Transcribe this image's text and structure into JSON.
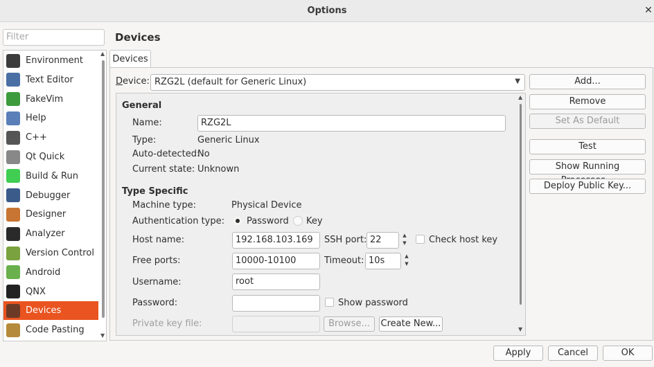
{
  "window": {
    "title": "Options",
    "close_glyph": "✕"
  },
  "filter": {
    "placeholder": "Filter",
    "value": ""
  },
  "sidebar": {
    "items": [
      {
        "label": "Environment",
        "icon": "environment-icon",
        "color": "#3c3c3c"
      },
      {
        "label": "Text Editor",
        "icon": "text-editor-icon",
        "color": "#4a6fa5"
      },
      {
        "label": "FakeVim",
        "icon": "fakevim-icon",
        "color": "#3d9b3d"
      },
      {
        "label": "Help",
        "icon": "help-icon",
        "color": "#5b7fb8"
      },
      {
        "label": "C++",
        "icon": "cpp-icon",
        "color": "#555555"
      },
      {
        "label": "Qt Quick",
        "icon": "qt-quick-icon",
        "color": "#888888"
      },
      {
        "label": "Build & Run",
        "icon": "build-run-icon",
        "color": "#41cd52"
      },
      {
        "label": "Debugger",
        "icon": "debugger-icon",
        "color": "#3b5b8a"
      },
      {
        "label": "Designer",
        "icon": "designer-icon",
        "color": "#c87533"
      },
      {
        "label": "Analyzer",
        "icon": "analyzer-icon",
        "color": "#2a2a2a"
      },
      {
        "label": "Version Control",
        "icon": "version-control-icon",
        "color": "#7aa33f"
      },
      {
        "label": "Android",
        "icon": "android-icon",
        "color": "#6ab04c"
      },
      {
        "label": "QNX",
        "icon": "qnx-icon",
        "color": "#222222"
      },
      {
        "label": "Devices",
        "icon": "devices-icon",
        "color": "#6b3a26"
      },
      {
        "label": "Code Pasting",
        "icon": "code-pasting-icon",
        "color": "#b58a3a"
      }
    ],
    "selected": "Devices"
  },
  "page": {
    "title": "Devices",
    "tab": "Devices"
  },
  "device": {
    "label": "Device:",
    "value": "RZG2L (default for Generic Linux)"
  },
  "actions": {
    "add": "Add...",
    "remove": "Remove",
    "set_default": "Set As Default",
    "test": "Test",
    "show_processes": "Show Running Processes...",
    "deploy_key": "Deploy Public Key..."
  },
  "general": {
    "heading": "General",
    "name_label": "Name:",
    "name_value": "RZG2L",
    "type_label": "Type:",
    "type_value": "Generic Linux",
    "auto_label": "Auto-detected:",
    "auto_value": "No",
    "state_label": "Current state:",
    "state_value": "Unknown"
  },
  "specific": {
    "heading": "Type Specific",
    "machine_label": "Machine type:",
    "machine_value": "Physical Device",
    "auth_label": "Authentication type:",
    "auth_password": "Password",
    "auth_key": "Key",
    "host_label": "Host name:",
    "host_value": "192.168.103.169",
    "ssh_label": "SSH port:",
    "ssh_value": "22",
    "check_host_label": "Check host key",
    "ports_label": "Free ports:",
    "ports_value": "10000-10100",
    "timeout_label": "Timeout:",
    "timeout_value": "10s",
    "user_label": "Username:",
    "user_value": "root",
    "password_label": "Password:",
    "password_value": "",
    "show_password_label": "Show password",
    "key_file_label": "Private key file:",
    "browse_label": "Browse...",
    "create_new_label": "Create New..."
  },
  "footer": {
    "apply": "Apply",
    "cancel": "Cancel",
    "ok": "OK"
  },
  "colors": {
    "accent": "#e95420"
  }
}
